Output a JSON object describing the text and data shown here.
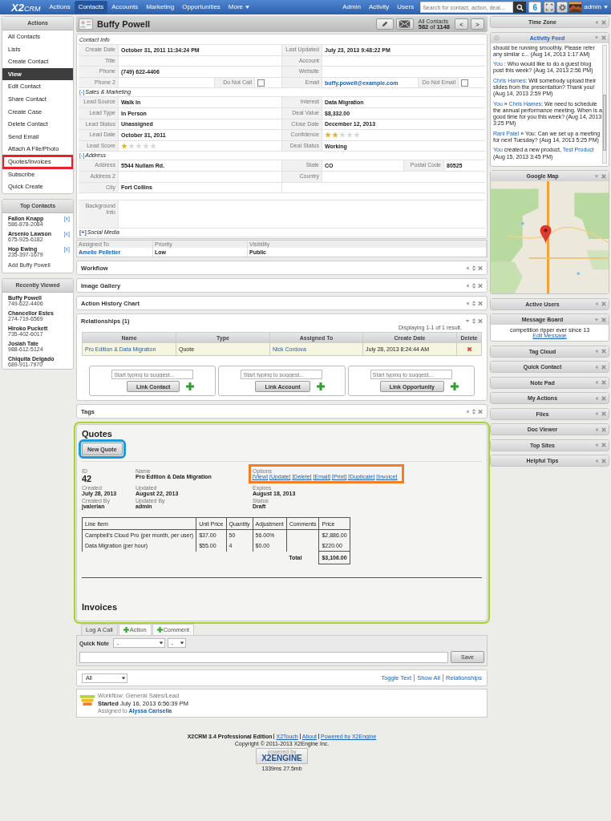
{
  "nav": {
    "logo": {
      "main": "X2",
      "sub": "CRM"
    },
    "items": [
      {
        "label": "Actions",
        "selected": false,
        "dropdown": false
      },
      {
        "label": "Contacts",
        "selected": true,
        "dropdown": false
      },
      {
        "label": "Accounts",
        "selected": false,
        "dropdown": false
      },
      {
        "label": "Marketing",
        "selected": false,
        "dropdown": false
      },
      {
        "label": "Opportunities",
        "selected": false,
        "dropdown": false
      },
      {
        "label": "More",
        "selected": false,
        "dropdown": true
      }
    ],
    "right_links": [
      "Admin",
      "Activity",
      "Users"
    ],
    "search": {
      "placeholder": "Search for contact, action, deal..."
    },
    "notifications": "6",
    "user": "admin"
  },
  "sidebar": {
    "panels": [
      {
        "title": "Actions",
        "kind": "menu",
        "items": [
          {
            "label": "All Contacts",
            "selected": false,
            "highlighted": false
          },
          {
            "label": "Lists",
            "selected": false,
            "highlighted": false
          },
          {
            "label": "Create Contact",
            "selected": false,
            "highlighted": false
          },
          {
            "label": "View",
            "selected": true,
            "highlighted": false
          },
          {
            "label": "Edit Contact",
            "selected": false,
            "highlighted": false
          },
          {
            "label": "Share Contact",
            "selected": false,
            "highlighted": false
          },
          {
            "label": "Create Case",
            "selected": false,
            "highlighted": false
          },
          {
            "label": "Delete Contact",
            "selected": false,
            "highlighted": false
          },
          {
            "label": "Send Email",
            "selected": false,
            "highlighted": false
          },
          {
            "label": "Attach A File/Photo",
            "selected": false,
            "highlighted": false
          },
          {
            "label": "Quotes/Invoices",
            "selected": false,
            "highlighted": true
          },
          {
            "label": "Subscribe",
            "selected": false,
            "highlighted": false
          },
          {
            "label": "Quick Create",
            "selected": false,
            "highlighted": false
          }
        ]
      },
      {
        "title": "Top Contacts",
        "kind": "contacts",
        "items": [
          {
            "name": "Fallon Knapp",
            "phone": "586-878-2084",
            "remove": "[x]"
          },
          {
            "name": "Arsenio Lawson",
            "phone": "675-925-6182",
            "remove": "[x]"
          },
          {
            "name": "Hop Ewing",
            "phone": "235-397-1679",
            "remove": "[x]"
          }
        ],
        "footer": "Add Buffy Powell"
      },
      {
        "title": "Recently Viewed",
        "kind": "contacts",
        "items": [
          {
            "name": "Buffy Powell",
            "phone": "749-622-4406"
          },
          {
            "name": "Chancellor Estes",
            "phone": "274-719-6569"
          },
          {
            "name": "Hiroko Puckett",
            "phone": "735-402-6017"
          },
          {
            "name": "Josiah Tate",
            "phone": "988-612-5124"
          },
          {
            "name": "Chiquita Delgado",
            "phone": "689-911-7970"
          }
        ]
      }
    ]
  },
  "record": {
    "title": "Buffy Powell",
    "list_label": "All Contacts",
    "position": "**582** of **1148**",
    "prev": "<",
    "next": ">"
  },
  "details": {
    "sections": [
      {
        "title": "Contact Info",
        "rows": [
          {
            "kind": "pair",
            "left": [
              {
                "label": "Create Date",
                "kind": "text",
                "value": "October 31, 2011 11:34:24 PM"
              }
            ],
            "right": [
              {
                "label": "Last Updated",
                "kind": "text",
                "value": "July 23, 2013 9:48:22 PM"
              }
            ]
          },
          {
            "kind": "pair",
            "left": [
              {
                "label": "Title",
                "kind": "text"
              }
            ],
            "right": [
              {
                "label": "Account",
                "kind": "text"
              }
            ]
          },
          {
            "kind": "pair",
            "left": [
              {
                "label": "Phone",
                "kind": "text",
                "value": "(749) 622-4406"
              }
            ],
            "right": [
              {
                "label": "Website",
                "kind": "text"
              }
            ]
          },
          {
            "kind": "pair",
            "left": [
              {
                "label": "Phone 2",
                "kind": "text"
              },
              {
                "label": "Do Not Call",
                "kind": "checkbox",
                "checked": false
              }
            ],
            "right": [
              {
                "label": "Email",
                "kind": "link",
                "value": "buffy.powell@example.com"
              },
              {
                "label": "Do Not Email",
                "kind": "checkbox",
                "checked": false
              }
            ]
          }
        ]
      },
      {
        "title": "Sales & Marketing",
        "toggle": "[-]",
        "expanded": true,
        "rows": [
          {
            "kind": "pair",
            "left": [
              {
                "label": "Lead Source",
                "kind": "text",
                "value": "Walk In"
              }
            ],
            "right": [
              {
                "label": "Interest",
                "kind": "text",
                "value": "Data Migration"
              }
            ]
          },
          {
            "kind": "pair",
            "left": [
              {
                "label": "Lead Type",
                "kind": "text",
                "value": "In Person"
              }
            ],
            "right": [
              {
                "label": "Deal Value",
                "kind": "text",
                "value": "$8,332.00"
              }
            ]
          },
          {
            "kind": "pair",
            "left": [
              {
                "label": "Lead Status",
                "kind": "text",
                "value": "Unassigned"
              }
            ],
            "right": [
              {
                "label": "Close Date",
                "kind": "text",
                "value": "December 12, 2013"
              }
            ]
          },
          {
            "kind": "pair",
            "left": [
              {
                "label": "Lead Date",
                "kind": "text",
                "value": "October 31, 2011"
              }
            ],
            "right": [
              {
                "label": "Confidence",
                "kind": "stars",
                "stars": 2
              }
            ]
          },
          {
            "kind": "pair",
            "left": [
              {
                "label": "Lead Score",
                "kind": "stars",
                "stars": 1
              }
            ],
            "right": [
              {
                "label": "Deal Status",
                "kind": "text",
                "value": "Working"
              }
            ]
          }
        ]
      },
      {
        "title": "Address",
        "toggle": "[-]",
        "expanded": true,
        "rows": [
          {
            "kind": "pair",
            "left": [
              {
                "label": "Address",
                "kind": "text",
                "value": "5544 Nullam Rd."
              }
            ],
            "right": [
              {
                "label": "State",
                "kind": "text",
                "value": "CO"
              },
              {
                "label": "Postal Code",
                "kind": "text",
                "value": "80525"
              }
            ]
          },
          {
            "kind": "pair",
            "left": [
              {
                "label": "Address 2",
                "kind": "text"
              }
            ],
            "right": [
              {
                "label": "Country",
                "kind": "text"
              }
            ]
          },
          {
            "kind": "pair",
            "left": [
              {
                "label": "City",
                "kind": "text",
                "value": "Fort Collins"
              }
            ],
            "right": []
          },
          {
            "kind": "blank"
          },
          {
            "kind": "wide",
            "left": [
              {
                "label": "Background Info",
                "kind": "text"
              }
            ]
          }
        ]
      },
      {
        "title": "Social Media",
        "toggle": "[+]",
        "expanded": false
      }
    ]
  },
  "assignment": {
    "columns": [
      "Assigned To",
      "Priority",
      "Visibility"
    ],
    "values": [
      {
        "text": "Amelie Pelletier",
        "kind": "link"
      },
      {
        "text": "Low",
        "kind": "text"
      },
      {
        "text": "Public",
        "kind": "text"
      }
    ]
  },
  "widgets": [
    {
      "title": "Workflow",
      "expanded": false,
      "kind": "plain"
    },
    {
      "title": "Image Gallery",
      "expanded": false,
      "kind": "plain"
    },
    {
      "title": "Action History Chart",
      "expanded": false,
      "kind": "plain"
    },
    {
      "title": "Relationships (1)",
      "expanded": true,
      "kind": "relationships",
      "summary": "Displaying 1-1 of 1 result.",
      "columns": [
        "Name",
        "Type",
        "Assigned To",
        "Create Date",
        "Delete"
      ],
      "rows": [
        {
          "name": "Pro Edition & Data Migration",
          "type": "Quote",
          "assigned_to": "Nick Cordova",
          "create_date": "July 28, 2013 8:24:44 AM"
        }
      ],
      "link_boxes": [
        {
          "placeholder": "Start typing to suggest...",
          "button": "Link Contact"
        },
        {
          "placeholder": "Start typing to suggest...",
          "button": "Link Account"
        },
        {
          "placeholder": "Start typing to suggest...",
          "button": "Link Opportunity"
        }
      ]
    },
    {
      "title": "Tags",
      "expanded": false,
      "kind": "plain"
    }
  ],
  "quotes": {
    "highlighted": true,
    "title": "Quotes",
    "new_button": {
      "label": "New Quote",
      "highlighted": true
    },
    "fields": [
      [
        {
          "label": "ID",
          "kind": "big",
          "value": "42"
        },
        {
          "label": "Name",
          "kind": "text",
          "value": "Pro Edition & Data Migration"
        },
        {
          "label": "Options",
          "kind": "links",
          "highlighted": true,
          "links": [
            "[View]",
            "[Update]",
            "[Delete]",
            "[Email]",
            "[Print]",
            "[Duplicate]",
            "[Invoice]"
          ]
        }
      ],
      [
        {
          "label": "Created",
          "kind": "text",
          "value": "July 28, 2013"
        },
        {
          "label": "Updated",
          "kind": "text",
          "value": "August 22, 2013"
        },
        {
          "label": "Expires",
          "kind": "text",
          "value": "August 18, 2013"
        }
      ],
      [
        {
          "label": "Created By",
          "kind": "text",
          "value": "jvalerian"
        },
        {
          "label": "Updated By",
          "kind": "text",
          "value": "admin"
        },
        {
          "label": "Status",
          "kind": "text",
          "value": "Draft"
        }
      ]
    ],
    "line_items": {
      "columns": [
        "Line Item",
        "Unit Price",
        "Quantity",
        "Adjustment",
        "Comments",
        "Price"
      ],
      "rows": [
        {
          "item": "Campbell's Cloud Pro (per month, per user)",
          "unit_price": "$37.00",
          "quantity": "50",
          "adjustment": "56.00%",
          "price": "$2,886.00"
        },
        {
          "item": "Data Migration (per hour)",
          "unit_price": "$55.00",
          "quantity": "4",
          "adjustment": "$0.00",
          "price": "$220.00"
        }
      ],
      "total_label": "Total",
      "total": "$3,106.00"
    },
    "invoices_title": "Invoices"
  },
  "publisher": {
    "tabs": [
      {
        "label": "Log A Call",
        "selected": true,
        "plus": false
      },
      {
        "label": "Action",
        "selected": false,
        "plus": true
      },
      {
        "label": "Comment",
        "selected": false,
        "plus": true
      }
    ],
    "quick_note_label": "Quick Note",
    "selects": [
      "-",
      "-"
    ],
    "save": "Save"
  },
  "history": {
    "filter": "All",
    "links": [
      "Toggle Text",
      "Show All",
      "Relationships"
    ],
    "items": [
      {
        "title": "Workflow: General Sales/Lead",
        "started": "**Started** July 16, 2013 6:56:39 PM",
        "assigned_label": "Assigned to",
        "assignee": "Alyssa Carisella"
      }
    ]
  },
  "footer": {
    "edition": "X2CRM 3.4 Professional Edition",
    "links": [
      "X2Touch",
      "About",
      "Powered by X2Engine"
    ],
    "copyright": "Copyright © 2011-2013 X2Engine Inc.",
    "badge": {
      "top": "powered by",
      "main": "X2ENGINE"
    },
    "stats": "1339ms 27.5mb"
  },
  "right_widgets": [
    {
      "title": "Time Zone",
      "expanded": false,
      "kind": "plain"
    },
    {
      "title": "Activity Feed",
      "expanded": true,
      "kind": "feed",
      "entries": [
        [
          {
            "text": "should be running smoothly. Please refer any similar c... (Aug 14, 2013 1:17 AM)",
            "kind": "text"
          }
        ],
        [
          {
            "text": "You",
            "kind": "link"
          },
          {
            "text": " : Who would like to do a guest blog post this week? (Aug 14, 2013 2:56 PM)",
            "kind": "text"
          }
        ],
        [
          {
            "text": "Chris Hames",
            "kind": "link"
          },
          {
            "text": ": Will somebody upload their slides from the presentation? Thank you! (Aug 14, 2013 2:59 PM)",
            "kind": "text"
          }
        ],
        [
          {
            "text": "You",
            "kind": "link"
          },
          {
            "text": " » ",
            "kind": "text"
          },
          {
            "text": "Chris Hames",
            "kind": "link"
          },
          {
            "text": ": We need to schedule the annual performance meeting. When is a good time for you this week? (Aug 14, 2013 3:25 PM)",
            "kind": "text"
          }
        ],
        [
          {
            "text": "Rani Patel",
            "kind": "link"
          },
          {
            "text": " » You: Can we set up a meeting for next Tuesday? (Aug 14, 2013 5:25 PM)",
            "kind": "text"
          }
        ],
        [
          {
            "text": "You",
            "kind": "link"
          },
          {
            "text": " created a new product, ",
            "kind": "text"
          },
          {
            "text": "Test Product",
            "kind": "link"
          },
          {
            "text": " (Aug 15, 2013 3:45 PM)",
            "kind": "text"
          }
        ]
      ]
    },
    {
      "title": "Google Map",
      "expanded": true,
      "kind": "map"
    },
    {
      "title": "Active Users",
      "expanded": false,
      "kind": "plain"
    },
    {
      "title": "Message Board",
      "expanded": true,
      "kind": "message",
      "message": "competition ripper ever since 13",
      "link": "Edit Message"
    },
    {
      "title": "Tag Cloud",
      "expanded": false,
      "kind": "plain"
    },
    {
      "title": "Quick Contact",
      "expanded": false,
      "kind": "plain"
    },
    {
      "title": "Note Pad",
      "expanded": false,
      "kind": "plain"
    },
    {
      "title": "My Actions",
      "expanded": false,
      "kind": "plain"
    },
    {
      "title": "Files",
      "expanded": false,
      "kind": "plain"
    },
    {
      "title": "Doc Viewer",
      "expanded": false,
      "kind": "plain"
    },
    {
      "title": "Top Sites",
      "expanded": false,
      "kind": "plain"
    },
    {
      "title": "Helpful Tips",
      "expanded": false,
      "kind": "plain"
    }
  ]
}
